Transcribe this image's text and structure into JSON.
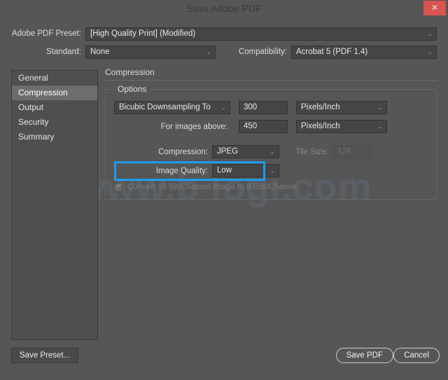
{
  "window": {
    "title": "Save Adobe PDF",
    "close_label": "✕",
    "close_icon": "close-icon",
    "accent_color": "#1f9bef",
    "close_color": "#d9534f",
    "background": "#565656"
  },
  "watermark": {
    "text": "www.b          logi.com"
  },
  "top": {
    "preset_label": "Adobe PDF Preset:",
    "preset_value": "[High Quality Print] (Modified)",
    "standard_label": "Standard:",
    "standard_value": "None",
    "compatibility_label": "Compatibility:",
    "compatibility_value": "Acrobat 5 (PDF 1.4)",
    "chevron": "⌄"
  },
  "sidebar": {
    "items": [
      {
        "label": "General",
        "selected": false
      },
      {
        "label": "Compression",
        "selected": true
      },
      {
        "label": "Output",
        "selected": false
      },
      {
        "label": "Security",
        "selected": false
      },
      {
        "label": "Summary",
        "selected": false
      }
    ]
  },
  "panel": {
    "title": "Compression",
    "group_legend": "Options",
    "downsample_value": "Bicubic Downsampling To",
    "resolution_value": "300",
    "unit_1": "Pixels/Inch",
    "for_images_above_label": "For images above:",
    "for_images_above_value": "450",
    "unit_2": "Pixels/Inch",
    "compression_label": "Compression:",
    "compression_value": "JPEG",
    "tile_size_label": "Tile Size:",
    "tile_size_value": "128",
    "image_quality_label": "Image Quality:",
    "image_quality_value": "Low",
    "convert_checkbox_label": "Convert 16 Bit/Channel Image to 8 Bits/Channe",
    "convert_checked": true,
    "chevron": "⌄"
  },
  "footer": {
    "save_preset_label": "Save Preset...",
    "save_pdf_label": "Save PDF",
    "cancel_label": "Cancel"
  }
}
